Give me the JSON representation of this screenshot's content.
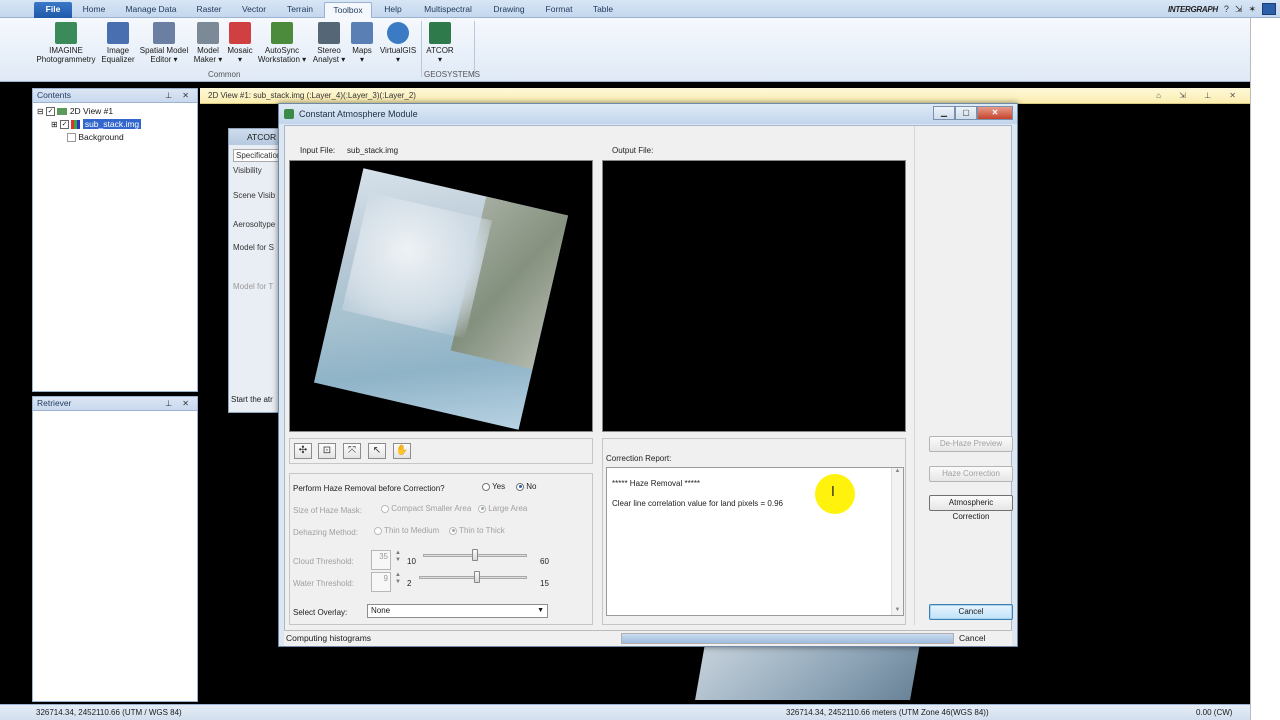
{
  "ribbon": {
    "file": "File",
    "tabs": [
      "Home",
      "Manage Data",
      "Raster",
      "Vector",
      "Terrain",
      "Toolbox",
      "Help",
      "Multispectral",
      "Drawing",
      "Format",
      "Table"
    ],
    "active_tab": "Toolbox",
    "brand": "INTERGRAPH",
    "tools": [
      {
        "label": "IMAGINE\nPhotogrammetry",
        "icon": "photogrammetry-icon",
        "color": "#3a8a5a"
      },
      {
        "label": "Image\nEqualizer",
        "icon": "image-equalizer-icon",
        "color": "#4a6fb0"
      },
      {
        "label": "Spatial Model\nEditor ▾",
        "icon": "spatial-model-icon",
        "color": "#6b7fa3"
      },
      {
        "label": "Model\nMaker ▾",
        "icon": "model-maker-icon",
        "color": "#7b8a96"
      },
      {
        "label": "Mosaic\n▾",
        "icon": "mosaic-icon",
        "color": "#d04040"
      },
      {
        "label": "AutoSync\nWorkstation ▾",
        "icon": "autosync-icon",
        "color": "#4b8b3b"
      },
      {
        "label": "Stereo\nAnalyst ▾",
        "icon": "stereo-analyst-icon",
        "color": "#556677"
      },
      {
        "label": "Maps\n▾",
        "icon": "maps-icon",
        "color": "#5a7fb5"
      },
      {
        "label": "VirtualGIS\n▾",
        "icon": "virtualgis-icon",
        "color": "#3b7bc4"
      },
      {
        "label": "ATCOR\n▾",
        "icon": "atcor-icon",
        "color": "#2f7a4a"
      }
    ],
    "group_common": "Common",
    "group_geosystems": "GEOSYSTEMS"
  },
  "contents": {
    "title": "Contents",
    "view": "2D View #1",
    "layer": "sub_stack.img",
    "background": "Background"
  },
  "retriever": {
    "title": "Retriever"
  },
  "viewer": {
    "title": "2D View #1: sub_stack.img (:Layer_4)(:Layer_3)(:Layer_2)"
  },
  "atcor_window": {
    "title": "ATCOR",
    "tab": "Specification",
    "rows": [
      "Visibility",
      "Scene Visib",
      "Aerosoltype",
      "Model for S",
      "Model for T"
    ],
    "status": "Start the atr"
  },
  "dialog": {
    "title": "Constant Atmosphere Module",
    "input_label": "Input File:",
    "input_value": "sub_stack.img",
    "output_label": "Output File:",
    "haze_question": "Perform Haze Removal before Correction?",
    "yes": "Yes",
    "no": "No",
    "haze_mask_label": "Size of Haze Mask:",
    "compact": "Compact Smaller Area",
    "large": "Large Area",
    "dehazing_label": "Dehazing Method:",
    "thin_medium": "Thin to Medium",
    "thin_thick": "Thin to Thick",
    "cloud_label": "Cloud Threshold:",
    "cloud_value": "35",
    "cloud_min": "10",
    "cloud_max": "60",
    "cloud_level": 0.5,
    "water_label": "Water Threshold:",
    "water_value": "9",
    "water_min": "2",
    "water_max": "15",
    "water_level": 0.54,
    "overlay_label": "Select Overlay:",
    "overlay_value": "None",
    "report_label": "Correction Report:",
    "report_line1": "***** Haze Removal *****",
    "report_line2": "Clear line correlation value for land pixels = 0.96",
    "btn_dehaze": "De-Haze Preview",
    "btn_haze": "Haze Correction",
    "btn_atmo": "Atmospheric Correction",
    "btn_cancel": "Cancel",
    "status": "Computing histograms",
    "status_cancel": "Cancel",
    "progress": 1.0
  },
  "statusbar": {
    "left": "326714.34, 2452110.66  (UTM / WGS 84)",
    "mid": "326714.34, 2452110.66 meters (UTM Zone 46(WGS 84))",
    "right": "0.00 (CW)"
  }
}
